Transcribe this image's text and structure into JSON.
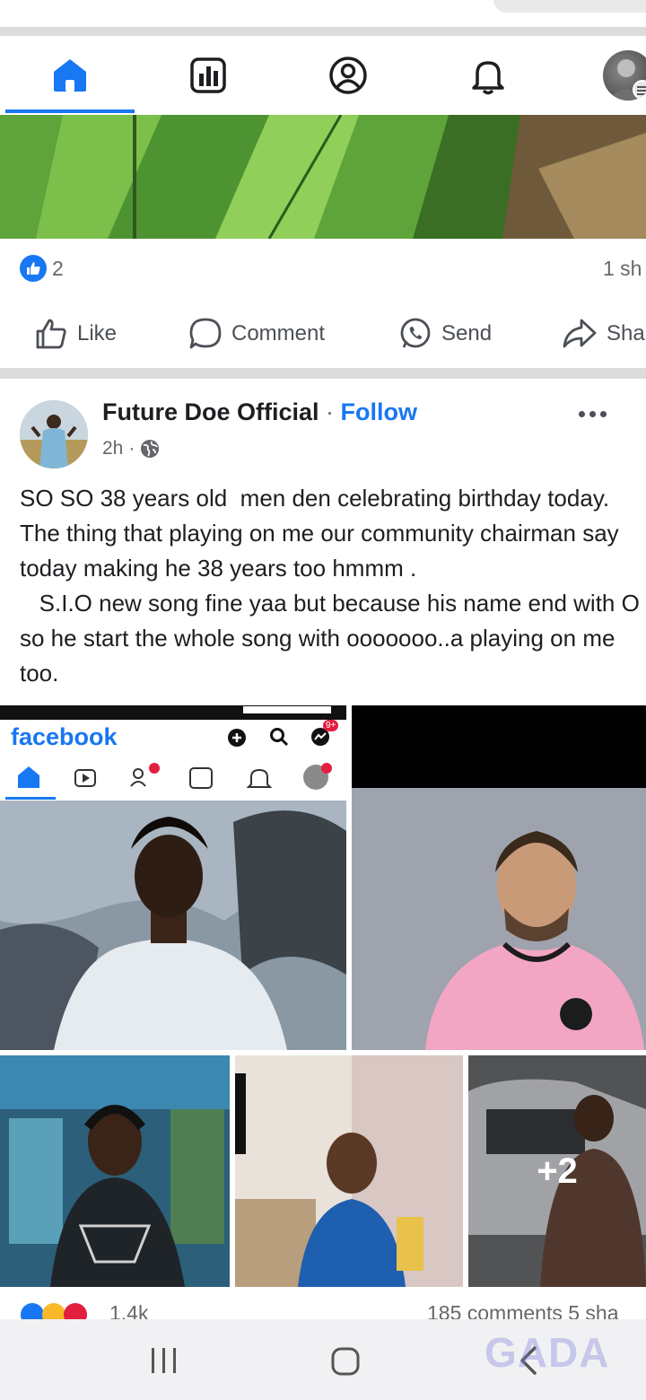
{
  "nav": {
    "tabs": [
      "home-icon",
      "stats-icon",
      "profile-icon",
      "bell-icon",
      "avatar"
    ],
    "accent": "#1877f2"
  },
  "post1": {
    "like_count": "2",
    "shares": "1 sh",
    "actions": {
      "like": "Like",
      "comment": "Comment",
      "send": "Send",
      "share": "Sha"
    }
  },
  "post2": {
    "author": "Future Doe Official",
    "separator": " · ",
    "follow": "Follow",
    "time": "2h",
    "time_separator": "·",
    "text": "SO SO 38 years old  men den celebrating birthday today. The thing that playing on me our community chairman say today making he 38 years too hmmm .\n   S.I.O new song fine yaa but because his name end with O so he start the whole song with ooooooo..a playing on me too.",
    "embedded_screenshot": {
      "brand": "facebook",
      "badge": "9+"
    },
    "more_photos": "+2",
    "reactions_count": "1.4k",
    "comments_shares": "185 comments  5 sha"
  },
  "watermark": "GADA"
}
